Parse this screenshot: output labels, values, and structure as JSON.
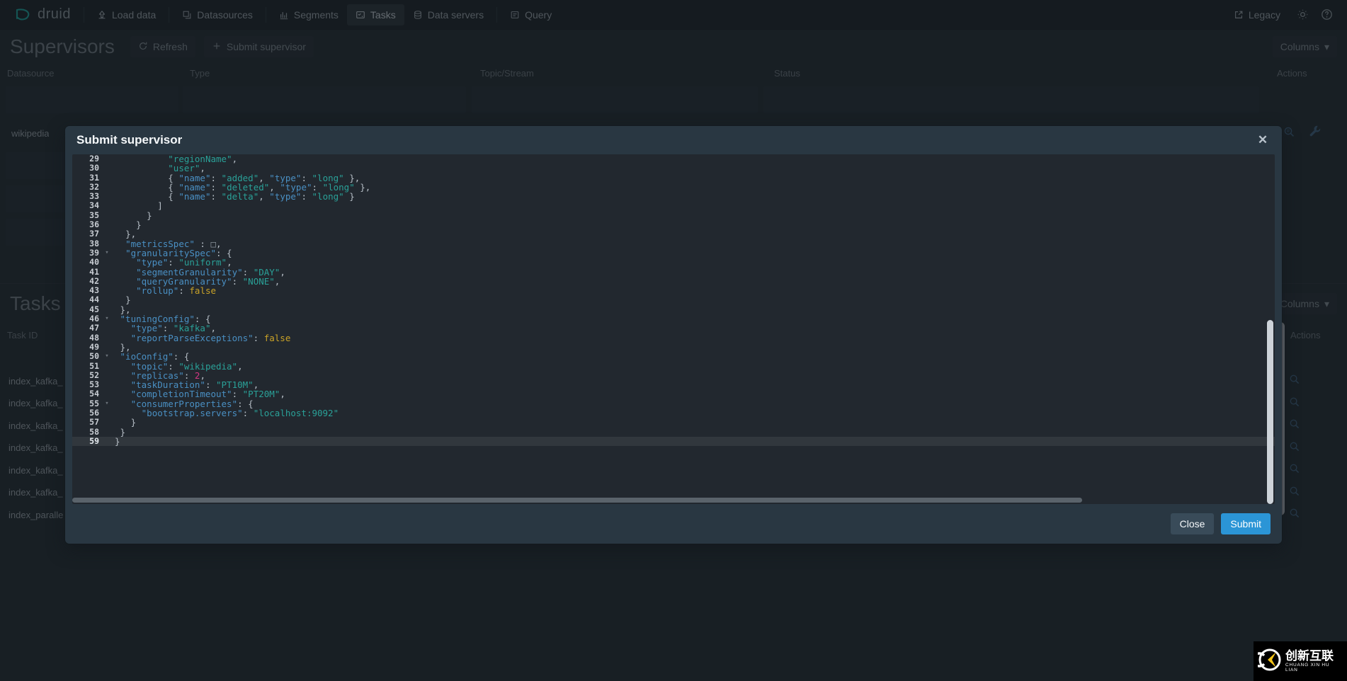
{
  "navbar": {
    "brand": "druid",
    "brand_icon": "druid-logo-icon",
    "items": [
      {
        "label": "Load data",
        "icon": "upload-icon",
        "active": false
      },
      {
        "label": "Datasources",
        "icon": "database-stack-icon",
        "active": false
      },
      {
        "label": "Segments",
        "icon": "segment-bars-icon",
        "active": false
      },
      {
        "label": "Tasks",
        "icon": "tasks-icon",
        "active": true
      },
      {
        "label": "Data servers",
        "icon": "server-icon",
        "active": false
      },
      {
        "label": "Query",
        "icon": "console-icon",
        "active": false
      }
    ],
    "legacy_label": "Legacy",
    "legacy_icon": "external-link-icon",
    "settings_icon": "gear-icon",
    "help_icon": "help-icon"
  },
  "supervisors": {
    "title": "Supervisors",
    "refresh_label": "Refresh",
    "refresh_icon": "refresh-icon",
    "submit_label": "Submit supervisor",
    "submit_icon": "plus-icon",
    "columns_label": "Columns",
    "columns_caret": "▾",
    "headers": [
      "Datasource",
      "Type",
      "Topic/Stream",
      "Status",
      "Actions"
    ],
    "rows": [
      {
        "datasource": "wikipedia"
      }
    ]
  },
  "tasks": {
    "title": "Tasks",
    "columns_label": "Columns",
    "columns_caret": "▾",
    "headers": [
      "Task ID",
      "Actions"
    ],
    "rows": [
      {
        "task_id": "index_kafka_"
      },
      {
        "task_id": "index_kafka_"
      },
      {
        "task_id": "index_kafka_"
      },
      {
        "task_id": "index_kafka_"
      },
      {
        "task_id": "index_kafka_"
      },
      {
        "task_id": "index_kafka_"
      },
      {
        "task_id": "index_paralle"
      }
    ]
  },
  "dialog": {
    "title": "Submit supervisor",
    "close_icon": "close-icon",
    "close_label": "Close",
    "submit_label": "Submit",
    "editor": {
      "first_visible_line": 29,
      "active_line": 59,
      "lines": [
        {
          "n": 29,
          "fold": "",
          "indent": 10,
          "tokens": [
            {
              "t": "str",
              "v": "\"regionName\""
            },
            {
              "t": "pun",
              "v": ","
            }
          ]
        },
        {
          "n": 30,
          "fold": "",
          "indent": 10,
          "tokens": [
            {
              "t": "str",
              "v": "\"user\""
            },
            {
              "t": "pun",
              "v": ","
            }
          ]
        },
        {
          "n": 31,
          "fold": "",
          "indent": 10,
          "tokens": [
            {
              "t": "pun",
              "v": "{ "
            },
            {
              "t": "key",
              "v": "\"name\""
            },
            {
              "t": "pun",
              "v": ": "
            },
            {
              "t": "str",
              "v": "\"added\""
            },
            {
              "t": "pun",
              "v": ", "
            },
            {
              "t": "key",
              "v": "\"type\""
            },
            {
              "t": "pun",
              "v": ": "
            },
            {
              "t": "str",
              "v": "\"long\""
            },
            {
              "t": "pun",
              "v": " },"
            }
          ]
        },
        {
          "n": 32,
          "fold": "",
          "indent": 10,
          "tokens": [
            {
              "t": "pun",
              "v": "{ "
            },
            {
              "t": "key",
              "v": "\"name\""
            },
            {
              "t": "pun",
              "v": ": "
            },
            {
              "t": "str",
              "v": "\"deleted\""
            },
            {
              "t": "pun",
              "v": ", "
            },
            {
              "t": "key",
              "v": "\"type\""
            },
            {
              "t": "pun",
              "v": ": "
            },
            {
              "t": "str",
              "v": "\"long\""
            },
            {
              "t": "pun",
              "v": " },"
            }
          ]
        },
        {
          "n": 33,
          "fold": "",
          "indent": 10,
          "tokens": [
            {
              "t": "pun",
              "v": "{ "
            },
            {
              "t": "key",
              "v": "\"name\""
            },
            {
              "t": "pun",
              "v": ": "
            },
            {
              "t": "str",
              "v": "\"delta\""
            },
            {
              "t": "pun",
              "v": ", "
            },
            {
              "t": "key",
              "v": "\"type\""
            },
            {
              "t": "pun",
              "v": ": "
            },
            {
              "t": "str",
              "v": "\"long\""
            },
            {
              "t": "pun",
              "v": " }"
            }
          ]
        },
        {
          "n": 34,
          "fold": "",
          "indent": 8,
          "tokens": [
            {
              "t": "pun",
              "v": "]"
            }
          ]
        },
        {
          "n": 35,
          "fold": "",
          "indent": 6,
          "tokens": [
            {
              "t": "pun",
              "v": "}"
            }
          ]
        },
        {
          "n": 36,
          "fold": "",
          "indent": 4,
          "tokens": [
            {
              "t": "pun",
              "v": "}"
            }
          ]
        },
        {
          "n": 37,
          "fold": "",
          "indent": 2,
          "tokens": [
            {
              "t": "pun",
              "v": "},"
            }
          ]
        },
        {
          "n": 38,
          "fold": "",
          "indent": 2,
          "tokens": [
            {
              "t": "key",
              "v": "\"metricsSpec\""
            },
            {
              "t": "pun",
              "v": " : "
            },
            {
              "t": "empty",
              "v": "□"
            },
            {
              "t": "pun",
              "v": ","
            }
          ]
        },
        {
          "n": 39,
          "fold": "▾",
          "indent": 2,
          "tokens": [
            {
              "t": "key",
              "v": "\"granularitySpec\""
            },
            {
              "t": "pun",
              "v": ": {"
            }
          ]
        },
        {
          "n": 40,
          "fold": "",
          "indent": 4,
          "tokens": [
            {
              "t": "key",
              "v": "\"type\""
            },
            {
              "t": "pun",
              "v": ": "
            },
            {
              "t": "str",
              "v": "\"uniform\""
            },
            {
              "t": "pun",
              "v": ","
            }
          ]
        },
        {
          "n": 41,
          "fold": "",
          "indent": 4,
          "tokens": [
            {
              "t": "key",
              "v": "\"segmentGranularity\""
            },
            {
              "t": "pun",
              "v": ": "
            },
            {
              "t": "str",
              "v": "\"DAY\""
            },
            {
              "t": "pun",
              "v": ","
            }
          ]
        },
        {
          "n": 42,
          "fold": "",
          "indent": 4,
          "tokens": [
            {
              "t": "key",
              "v": "\"queryGranularity\""
            },
            {
              "t": "pun",
              "v": ": "
            },
            {
              "t": "str",
              "v": "\"NONE\""
            },
            {
              "t": "pun",
              "v": ","
            }
          ]
        },
        {
          "n": 43,
          "fold": "",
          "indent": 4,
          "tokens": [
            {
              "t": "key",
              "v": "\"rollup\""
            },
            {
              "t": "pun",
              "v": ": "
            },
            {
              "t": "bool",
              "v": "false"
            }
          ]
        },
        {
          "n": 44,
          "fold": "",
          "indent": 2,
          "tokens": [
            {
              "t": "pun",
              "v": "}"
            }
          ]
        },
        {
          "n": 45,
          "fold": "",
          "indent": 1,
          "tokens": [
            {
              "t": "pun",
              "v": "},"
            }
          ]
        },
        {
          "n": 46,
          "fold": "▾",
          "indent": 1,
          "tokens": [
            {
              "t": "key",
              "v": "\"tuningConfig\""
            },
            {
              "t": "pun",
              "v": ": {"
            }
          ]
        },
        {
          "n": 47,
          "fold": "",
          "indent": 3,
          "tokens": [
            {
              "t": "key",
              "v": "\"type\""
            },
            {
              "t": "pun",
              "v": ": "
            },
            {
              "t": "str",
              "v": "\"kafka\""
            },
            {
              "t": "pun",
              "v": ","
            }
          ]
        },
        {
          "n": 48,
          "fold": "",
          "indent": 3,
          "tokens": [
            {
              "t": "key",
              "v": "\"reportParseExceptions\""
            },
            {
              "t": "pun",
              "v": ": "
            },
            {
              "t": "bool",
              "v": "false"
            }
          ]
        },
        {
          "n": 49,
          "fold": "",
          "indent": 1,
          "tokens": [
            {
              "t": "pun",
              "v": "},"
            }
          ]
        },
        {
          "n": 50,
          "fold": "▾",
          "indent": 1,
          "tokens": [
            {
              "t": "key",
              "v": "\"ioConfig\""
            },
            {
              "t": "pun",
              "v": ": {"
            }
          ]
        },
        {
          "n": 51,
          "fold": "",
          "indent": 3,
          "tokens": [
            {
              "t": "key",
              "v": "\"topic\""
            },
            {
              "t": "pun",
              "v": ": "
            },
            {
              "t": "str",
              "v": "\"wikipedia\""
            },
            {
              "t": "pun",
              "v": ","
            }
          ]
        },
        {
          "n": 52,
          "fold": "",
          "indent": 3,
          "tokens": [
            {
              "t": "key",
              "v": "\"replicas\""
            },
            {
              "t": "pun",
              "v": ": "
            },
            {
              "t": "num",
              "v": "2"
            },
            {
              "t": "pun",
              "v": ","
            }
          ]
        },
        {
          "n": 53,
          "fold": "",
          "indent": 3,
          "tokens": [
            {
              "t": "key",
              "v": "\"taskDuration\""
            },
            {
              "t": "pun",
              "v": ": "
            },
            {
              "t": "str",
              "v": "\"PT10M\""
            },
            {
              "t": "pun",
              "v": ","
            }
          ]
        },
        {
          "n": 54,
          "fold": "",
          "indent": 3,
          "tokens": [
            {
              "t": "key",
              "v": "\"completionTimeout\""
            },
            {
              "t": "pun",
              "v": ": "
            },
            {
              "t": "str",
              "v": "\"PT20M\""
            },
            {
              "t": "pun",
              "v": ","
            }
          ]
        },
        {
          "n": 55,
          "fold": "▾",
          "indent": 3,
          "tokens": [
            {
              "t": "key",
              "v": "\"consumerProperties\""
            },
            {
              "t": "pun",
              "v": ": {"
            }
          ]
        },
        {
          "n": 56,
          "fold": "",
          "indent": 5,
          "tokens": [
            {
              "t": "key",
              "v": "\"bootstrap.servers\""
            },
            {
              "t": "pun",
              "v": ": "
            },
            {
              "t": "str",
              "v": "\"localhost:9092\""
            }
          ]
        },
        {
          "n": 57,
          "fold": "",
          "indent": 3,
          "tokens": [
            {
              "t": "pun",
              "v": "}"
            }
          ]
        },
        {
          "n": 58,
          "fold": "",
          "indent": 1,
          "tokens": [
            {
              "t": "pun",
              "v": "}"
            }
          ]
        },
        {
          "n": 59,
          "fold": "",
          "indent": 0,
          "tokens": [
            {
              "t": "pun",
              "v": "}"
            }
          ]
        }
      ]
    }
  },
  "watermark": {
    "cn": "创新互联",
    "en": "CHUANG XIN HU LIAN",
    "logo_icon": "cx-logo-icon"
  },
  "colors": {
    "accent": "#2b95d6",
    "dialog_bg": "#293742",
    "editor_bg": "#22282f",
    "app_bg": "#222a31",
    "navbar_bg": "#1c2228"
  }
}
